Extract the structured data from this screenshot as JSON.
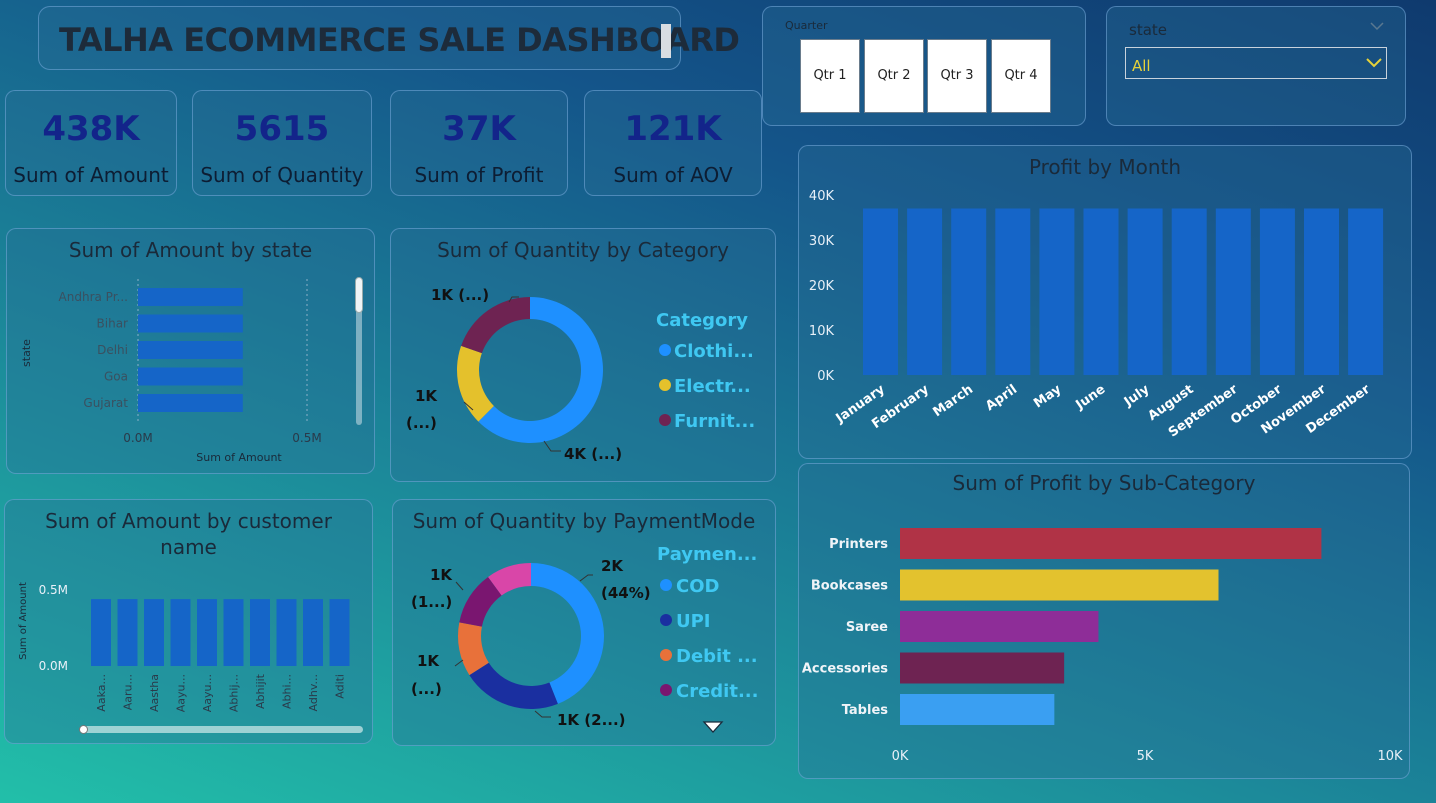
{
  "header": {
    "title": "TALHA ECOMMERCE SALE DASHBOARD"
  },
  "kpis": [
    {
      "value": "438K",
      "label": "Sum of Amount"
    },
    {
      "value": "5615",
      "label": "Sum of Quantity"
    },
    {
      "value": "37K",
      "label": "Sum of Profit"
    },
    {
      "value": "121K",
      "label": "Sum of AOV"
    }
  ],
  "quarter_slicer": {
    "label": "Quarter",
    "options": [
      "Qtr 1",
      "Qtr 2",
      "Qtr 3",
      "Qtr 4"
    ]
  },
  "state_slicer": {
    "label": "state",
    "selected": "All"
  },
  "colors": {
    "bar_blue": "#1565c8",
    "clothing": "#1e90ff",
    "electronics": "#e4c12c",
    "furniture": "#6e2352",
    "cod": "#1e90ff",
    "upi": "#1a2fa0",
    "debit": "#e8713a",
    "credit": "#7a1670",
    "pink": "#d946a8",
    "printers": "#b03346",
    "bookcases": "#e3c22e",
    "saree": "#8e2d98",
    "accessories": "#6e2352",
    "tables": "#3a9ff2"
  },
  "chart_data": [
    {
      "type": "bar",
      "title": "Sum of Amount by state",
      "orientation": "horizontal",
      "categories": [
        "Andhra Pr...",
        "Bihar",
        "Delhi",
        "Goa",
        "Gujarat"
      ],
      "values": [
        0.31,
        0.31,
        0.31,
        0.31,
        0.31
      ],
      "xlabel": "Sum of Amount",
      "ylabel": "state",
      "xticks": [
        "0.0M",
        "0.5M"
      ],
      "xlim": [
        0,
        0.5
      ]
    },
    {
      "type": "pie",
      "title": "Sum of Quantity by Category",
      "legend_title": "Category",
      "labels": [
        "Clothi...",
        "Electr...",
        "Furnit..."
      ],
      "values": [
        3.5,
        1.0,
        1.1
      ],
      "data_labels": [
        "4K (...)",
        "1K (...)",
        "1K (...)"
      ]
    },
    {
      "type": "bar",
      "title": "Profit by Month",
      "categories": [
        "January",
        "February",
        "March",
        "April",
        "May",
        "June",
        "July",
        "August",
        "September",
        "October",
        "November",
        "December"
      ],
      "values": [
        37000,
        37000,
        37000,
        37000,
        37000,
        37000,
        37000,
        37000,
        37000,
        37000,
        37000,
        37000
      ],
      "yticks": [
        "0K",
        "10K",
        "20K",
        "30K",
        "40K"
      ],
      "ylim": [
        0,
        40000
      ]
    },
    {
      "type": "bar",
      "title": "Sum of Amount by customer name",
      "categories": [
        "Aaka...",
        "Aaru...",
        "Aastha",
        "Aayu...",
        "Aayu...",
        "Abhij...",
        "Abhijit",
        "Abhi...",
        "Adhv...",
        "Aditi"
      ],
      "values": [
        0.44,
        0.44,
        0.44,
        0.44,
        0.44,
        0.44,
        0.44,
        0.44,
        0.44,
        0.44
      ],
      "ylabel": "Sum of Amount",
      "yticks": [
        "0.0M",
        "0.5M"
      ],
      "ylim": [
        0,
        0.5
      ]
    },
    {
      "type": "pie",
      "title": "Sum of Quantity by PaymentMode",
      "legend_title": "Paymen...",
      "labels": [
        "COD",
        "UPI",
        "Debit ...",
        "Credit..."
      ],
      "values": [
        44,
        22,
        12,
        12,
        10
      ],
      "data_labels": [
        "2K",
        "(44%)",
        "1K (2...)",
        "1K",
        "(...)",
        "1K",
        "(1...)"
      ]
    },
    {
      "type": "bar",
      "title": "Sum of Profit by Sub-Category",
      "orientation": "horizontal",
      "categories": [
        "Printers",
        "Bookcases",
        "Saree",
        "Accessories",
        "Tables"
      ],
      "values": [
        8600,
        6500,
        4050,
        3350,
        3150
      ],
      "xticks": [
        "0K",
        "5K",
        "10K"
      ],
      "xlim": [
        0,
        10000
      ]
    }
  ]
}
